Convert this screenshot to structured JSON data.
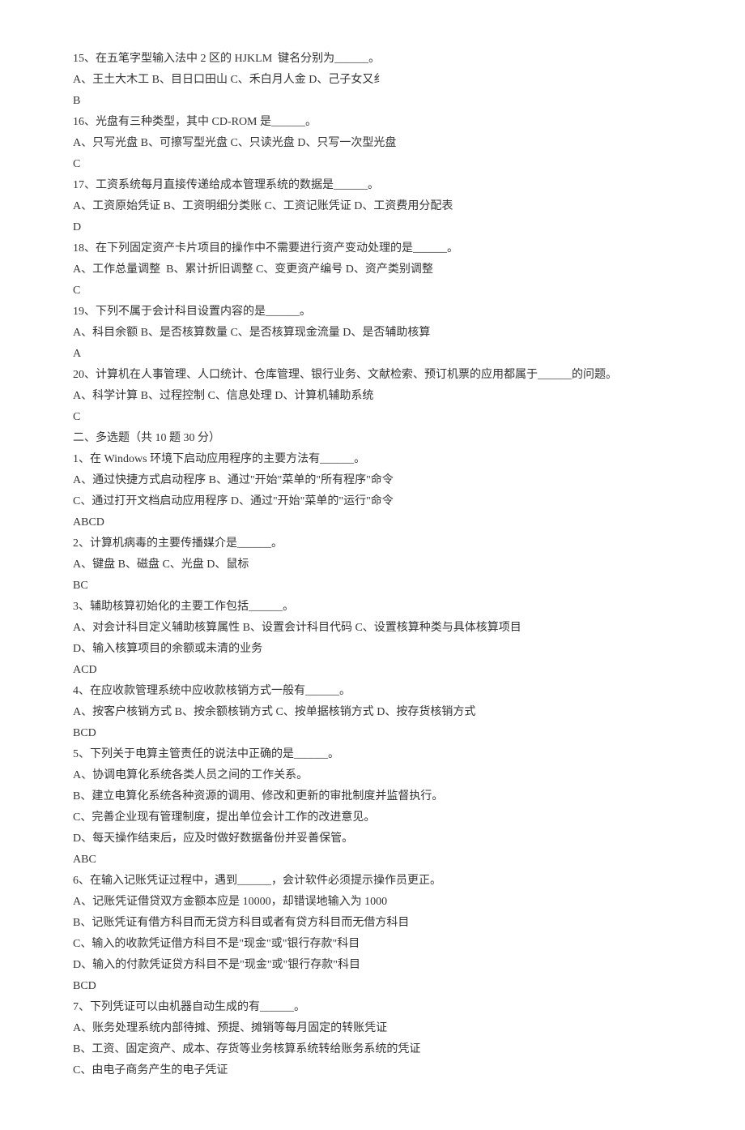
{
  "lines": [
    "15、在五笔字型输入法中 2 区的 HJKLM  键名分别为______。",
    "A、王土大木工 B、目日口田山 C、禾白月人金 D、己子女又纟",
    "B",
    "16、光盘有三种类型，其中 CD-ROM 是______。",
    "A、只写光盘 B、可擦写型光盘 C、只读光盘 D、只写一次型光盘",
    "C",
    "17、工资系统每月直接传递给成本管理系统的数据是______。",
    "A、工资原始凭证 B、工资明细分类账 C、工资记账凭证 D、工资费用分配表",
    "D",
    "18、在下列固定资产卡片项目的操作中不需要进行资产变动处理的是______。",
    "A、工作总量调整  B、累计折旧调整 C、变更资产编号 D、资产类别调整",
    "C",
    "19、下列不属于会计科目设置内容的是______。",
    "A、科目余额 B、是否核算数量 C、是否核算现金流量 D、是否辅助核算",
    "A",
    "20、计算机在人事管理、人口统计、仓库管理、银行业务、文献检索、预订机票的应用都属于______的问题。",
    "A、科学计算 B、过程控制 C、信息处理 D、计算机辅助系统",
    "C",
    "二、多选题（共 10 题 30 分）",
    "1、在 Windows 环境下启动应用程序的主要方法有______。",
    "A、通过快捷方式启动程序 B、通过\"开始\"菜单的\"所有程序\"命令",
    "C、通过打开文档启动应用程序 D、通过\"开始\"菜单的\"运行\"命令",
    "ABCD",
    "2、计算机病毒的主要传播媒介是______。",
    "A、键盘 B、磁盘 C、光盘 D、鼠标",
    "BC",
    "3、辅助核算初始化的主要工作包括______。",
    "A、对会计科目定义辅助核算属性 B、设置会计科目代码 C、设置核算种类与具体核算项目",
    "D、输入核算项目的余额或未清的业务",
    "ACD",
    "4、在应收款管理系统中应收款核销方式一般有______。",
    "A、按客户核销方式 B、按余额核销方式 C、按单据核销方式 D、按存货核销方式",
    "BCD",
    "5、下列关于电算主管责任的说法中正确的是______。",
    "A、协调电算化系统各类人员之间的工作关系。",
    "B、建立电算化系统各种资源的调用、修改和更新的审批制度并监督执行。",
    "C、完善企业现有管理制度，提出单位会计工作的改进意见。",
    "D、每天操作结束后，应及时做好数据备份并妥善保管。",
    "ABC",
    "6、在输入记账凭证过程中，遇到______，会计软件必须提示操作员更正。",
    "A、记账凭证借贷双方金额本应是 10000，却错误地输入为 1000",
    "B、记账凭证有借方科目而无贷方科目或者有贷方科目而无借方科目",
    "C、输入的收款凭证借方科目不是\"现金\"或\"银行存款\"科目",
    "D、输入的付款凭证贷方科目不是\"现金\"或\"银行存款\"科目",
    "BCD",
    "7、下列凭证可以由机器自动生成的有______。",
    "A、账务处理系统内部待摊、预提、摊销等每月固定的转账凭证",
    "B、工资、固定资产、成本、存货等业务核算系统转给账务系统的凭证",
    "C、由电子商务产生的电子凭证"
  ]
}
